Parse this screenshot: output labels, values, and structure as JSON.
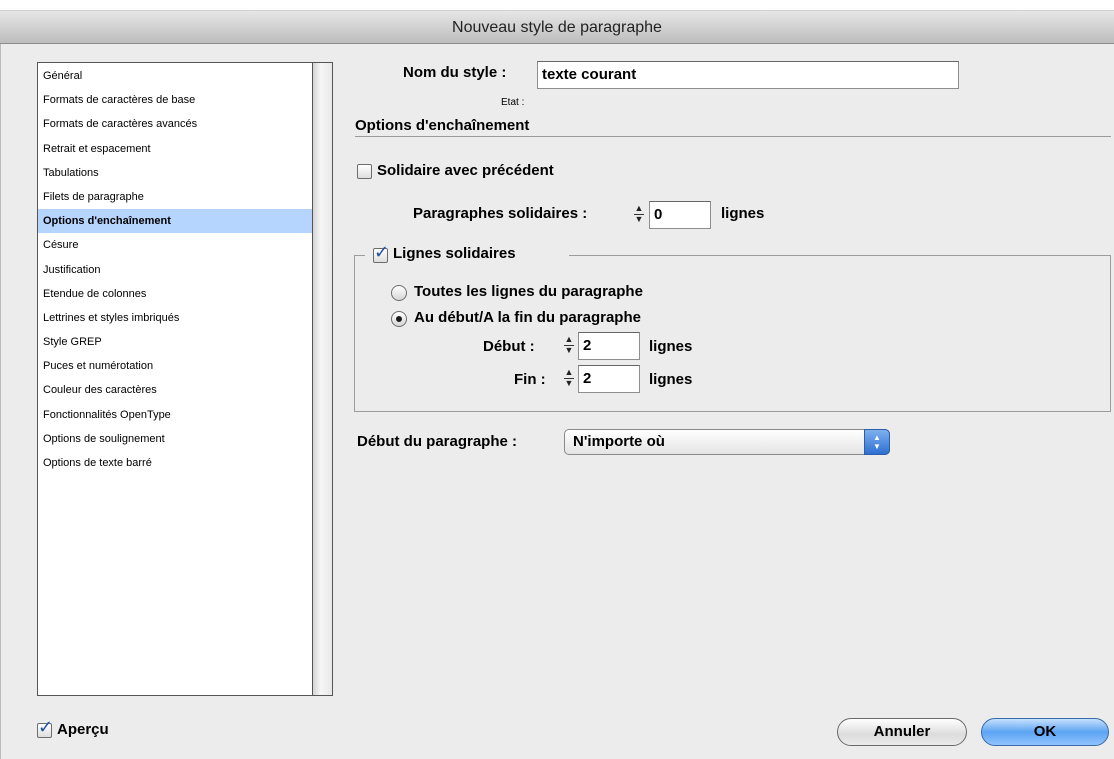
{
  "window": {
    "title": "Nouveau style de paragraphe"
  },
  "sidebar": {
    "items": [
      {
        "label": "Général"
      },
      {
        "label": "Formats de caractères de base"
      },
      {
        "label": "Formats de caractères avancés"
      },
      {
        "label": "Retrait et espacement"
      },
      {
        "label": "Tabulations"
      },
      {
        "label": "Filets de paragraphe"
      },
      {
        "label": "Options d'enchaînement",
        "selected": true
      },
      {
        "label": "Césure"
      },
      {
        "label": "Justification"
      },
      {
        "label": "Etendue de colonnes"
      },
      {
        "label": "Lettrines et styles imbriqués"
      },
      {
        "label": "Style GREP"
      },
      {
        "label": "Puces et numérotation"
      },
      {
        "label": "Couleur des caractères"
      },
      {
        "label": "Fonctionnalités OpenType"
      },
      {
        "label": "Options de soulignement"
      },
      {
        "label": "Options de texte barré"
      }
    ]
  },
  "style_name": {
    "label": "Nom du style :",
    "value": "texte courant",
    "state_label": "Etat :"
  },
  "section": {
    "title": "Options d'enchaînement"
  },
  "keep_with_previous": {
    "label": "Solidaire avec précédent",
    "checked": false
  },
  "keep_with_next": {
    "label": "Paragraphes solidaires :",
    "value": "0",
    "unit": "lignes"
  },
  "keep_lines": {
    "label": "Lignes solidaires",
    "checked": true,
    "options": [
      {
        "label": "Toutes les lignes du paragraphe",
        "selected": false
      },
      {
        "label": "Au début/A la fin du paragraphe",
        "selected": true
      }
    ],
    "start": {
      "label": "Début :",
      "value": "2",
      "unit": "lignes"
    },
    "end": {
      "label": "Fin :",
      "value": "2",
      "unit": "lignes"
    }
  },
  "paragraph_start": {
    "label": "Début du paragraphe :",
    "value": "N'importe où"
  },
  "preview": {
    "label": "Aperçu",
    "checked": true
  },
  "buttons": {
    "cancel": "Annuler",
    "ok": "OK"
  },
  "colors": {
    "selection": "#b5d5ff",
    "check": "#1e53a8",
    "default_button": "#5da4f2"
  }
}
